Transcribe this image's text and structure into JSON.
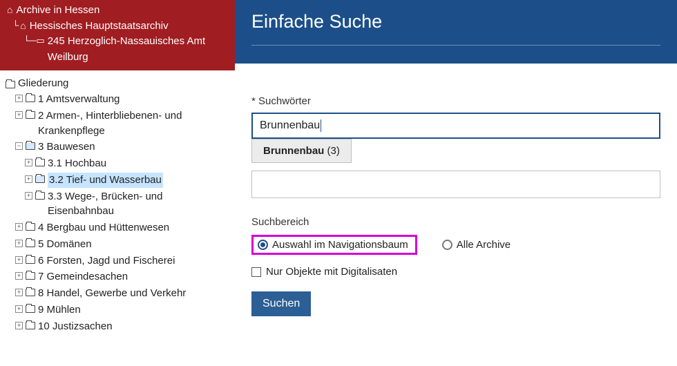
{
  "breadcrumb": {
    "root": "Archive in Hessen",
    "level1": "Hessisches Hauptstaatsarchiv",
    "level2": "245 Herzoglich-Nassauisches Amt Weilburg"
  },
  "tree": {
    "root": "Gliederung",
    "n1": "1 Amtsverwaltung",
    "n2": "2 Armen-, Hinterbliebenen- und Krankenpflege",
    "n3": "3 Bauwesen",
    "n3_1": "3.1 Hochbau",
    "n3_2": "3.2 Tief- und Wasserbau",
    "n3_3": "3.3 Wege-, Brücken- und Eisenbahnbau",
    "n4": "4 Bergbau und Hüttenwesen",
    "n5": "5 Domänen",
    "n6": "6 Forsten, Jagd und Fischerei",
    "n7": "7 Gemeindesachen",
    "n8": "8 Handel, Gewerbe und Verkehr",
    "n9": "9 Mühlen",
    "n10": "10 Justizsachen"
  },
  "form": {
    "title": "Einfache Suche",
    "keywords_label": "* Suchwörter",
    "keywords_value": "Brunnenbau",
    "suggest_term": "Brunnenbau",
    "suggest_count": "(3)",
    "scope_label": "Suchbereich",
    "radio_nav": "Auswahl im Navigationsbaum",
    "radio_all": "Alle Archive",
    "digital_only": "Nur Objekte mit Digitalisaten",
    "submit": "Suchen"
  }
}
